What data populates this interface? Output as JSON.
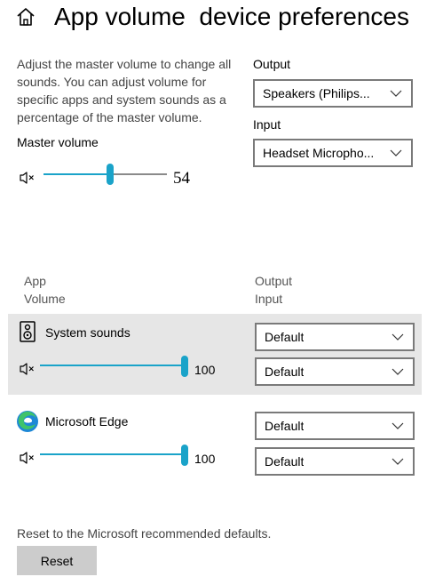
{
  "header": {
    "title": "App volume  device preferences",
    "home_icon": "home-icon"
  },
  "master": {
    "description": "Adjust the master volume to change all sounds. You can adjust volume for specific apps and system sounds as a percentage of the master volume.",
    "label": "Master volume",
    "value": "54",
    "level": 0.54,
    "mute_icon": "speaker-mute-icon"
  },
  "output": {
    "label": "Output",
    "selected": "Speakers (Philips..."
  },
  "input": {
    "label": "Input",
    "selected": "Headset Micropho..."
  },
  "columns": {
    "app": "App",
    "volume": "Volume",
    "output": "Output",
    "input": "Input"
  },
  "apps": [
    {
      "name": "System sounds",
      "icon": "system-sounds-speaker-icon",
      "value": "100",
      "level": 1.0,
      "output": "Default",
      "input": "Default",
      "highlighted": true
    },
    {
      "name": "Microsoft Edge",
      "icon": "microsoft-edge-icon",
      "value": "100",
      "level": 1.0,
      "output": "Default",
      "input": "Default",
      "highlighted": false
    }
  ],
  "reset": {
    "text": "Reset to the Microsoft recommended defaults.",
    "button_label": "Reset"
  },
  "colors": {
    "accent": "#1aa3c9",
    "row_highlight": "#e6e6e6",
    "button_bg": "#cccccc"
  }
}
